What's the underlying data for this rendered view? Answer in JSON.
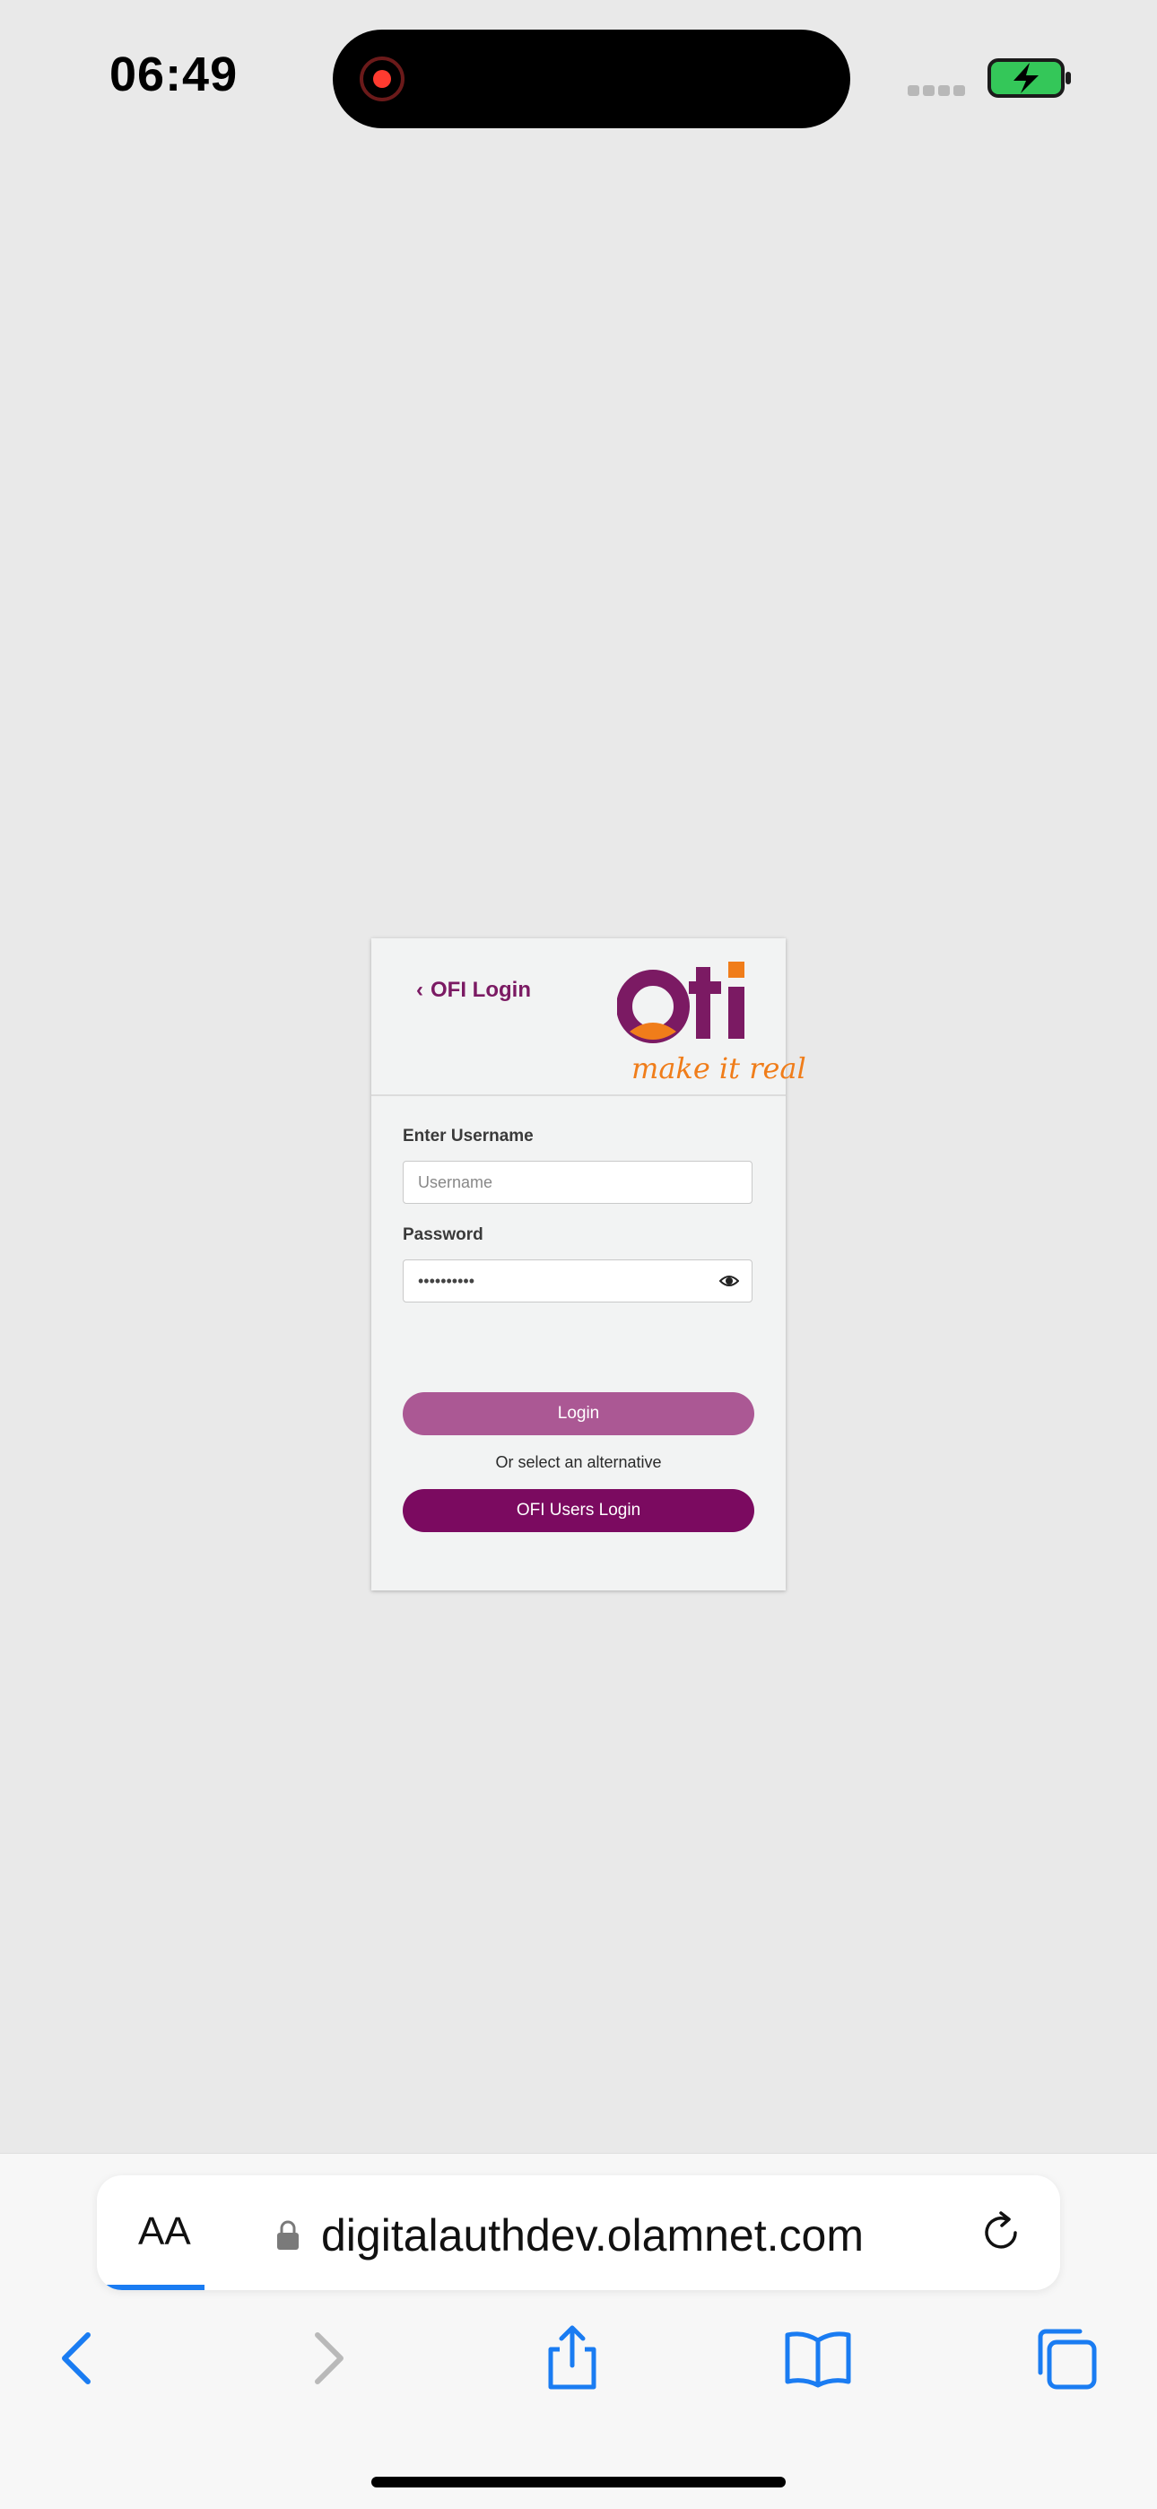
{
  "status_bar": {
    "time": "06:49",
    "icons": [
      "recording-indicator",
      "cellular-signal",
      "battery-charging"
    ]
  },
  "login_card": {
    "back_label": "OFI Login",
    "logo_word": "ofi",
    "logo_tagline": "make it real",
    "username_label": "Enter Username",
    "username_placeholder": "Username",
    "password_label": "Password",
    "password_value": "••••••••••",
    "login_button": "Login",
    "alternative_text": "Or select an alternative",
    "ofi_users_button": "OFI Users Login"
  },
  "browser": {
    "text_size_label": "AA",
    "url": "digitalauthdev.olamnet.com",
    "toolbar": [
      "back-icon",
      "forward-icon",
      "share-icon",
      "bookmarks-icon",
      "tabs-icon"
    ]
  },
  "colors": {
    "brand_purple": "#7b0a60",
    "brand_orange": "#f07d1a",
    "login_button": "#ab5894",
    "safari_blue": "#1a7cf2"
  }
}
